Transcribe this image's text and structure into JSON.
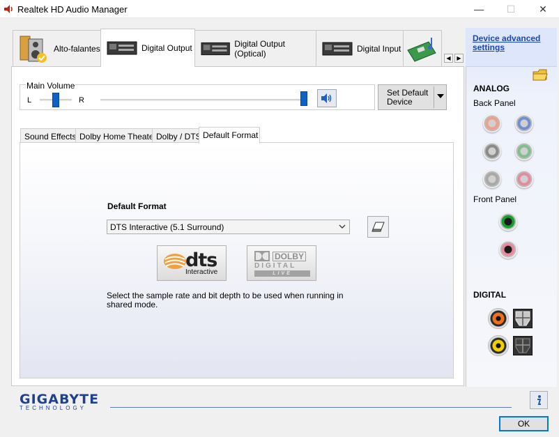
{
  "window": {
    "title": "Realtek HD Audio Manager",
    "icons": {
      "app": "speaker-icon",
      "minimize": "minimize-icon",
      "maximize": "maximize-icon",
      "close": "close-icon"
    }
  },
  "device_tabs": [
    {
      "label": "Alto-falantes",
      "active": false
    },
    {
      "label": "Digital Output",
      "active": true
    },
    {
      "label": "Digital Output (Optical)",
      "active": false
    },
    {
      "label": "Digital Input",
      "active": false
    }
  ],
  "volume": {
    "label": "Main Volume",
    "left_label": "L",
    "right_label": "R",
    "balance": 0.5,
    "level": 1.0
  },
  "set_default": {
    "label": "Set Default Device"
  },
  "sub_tabs": [
    {
      "label": "Sound Effects",
      "active": false
    },
    {
      "label": "Dolby Home Theater",
      "active": false
    },
    {
      "label": "Dolby / DTS",
      "active": false
    },
    {
      "label": "Default Format",
      "active": true
    }
  ],
  "default_format": {
    "label": "Default Format",
    "selected": "DTS Interactive (5.1 Surround)",
    "description": "Select the sample rate and bit depth to be used when running in shared mode.",
    "dts_logo": {
      "word": "dts",
      "sub": "Interactive"
    },
    "dolby_logo": {
      "word": "DOLBY",
      "digital": "DIGITAL",
      "live": "LIVE"
    }
  },
  "right_panel": {
    "advanced_link": "Device advanced settings",
    "analog_label": "ANALOG",
    "back_panel_label": "Back Panel",
    "front_panel_label": "Front Panel",
    "digital_label": "DIGITAL",
    "back_jacks": [
      "#f0a08a",
      "#6f8fd0",
      "#8a8a8a",
      "#7fbf8f",
      "#a8a8a8",
      "#e58aa0"
    ],
    "front_jacks": [
      "#13a02d",
      "#e88aa0"
    ],
    "digital_colors": [
      "#f07020",
      "#f0d000"
    ]
  },
  "footer": {
    "brand": "GIGABYTE",
    "brand_sub": "TECHNOLOGY",
    "ok_label": "OK"
  },
  "colors": {
    "accent": "#0078d7",
    "slider": "#0b63c5",
    "link": "#1a47b8",
    "brand": "#1f3f8f"
  }
}
